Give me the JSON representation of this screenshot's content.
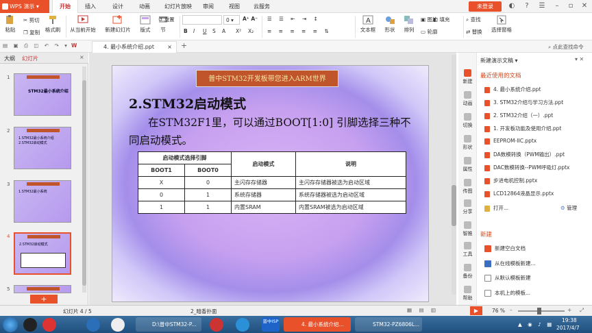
{
  "app": {
    "name": "WPS 演示",
    "login_label": "未登录"
  },
  "menu_tabs": [
    "开始",
    "插入",
    "设计",
    "动画",
    "幻灯片放映",
    "审阅",
    "视图",
    "云服务"
  ],
  "ribbon": {
    "paste": "粘贴",
    "cut": "剪切",
    "copy": "复制",
    "format_painter": "格式刷",
    "from_current": "从当前开始",
    "new_slide": "新建幻灯片",
    "layout": "版式",
    "section": "节",
    "reset": "重置",
    "font_size": "0",
    "textbox": "文本框",
    "shape": "形状",
    "arrange": "排列",
    "picture": "图片",
    "fill": "填充",
    "outline": "轮廓",
    "find": "查找",
    "replace": "替换",
    "select_pane": "选择窗格"
  },
  "quickbar": {
    "doc_tab": "4. 最小系统介绍.ppt",
    "quick_search": "点此查找命令"
  },
  "left_panel": {
    "tab_outline": "大纲",
    "tab_slides": "幻灯片"
  },
  "thumbnails": [
    {
      "num": "1",
      "text": "STM32最小系统介绍"
    },
    {
      "num": "2",
      "text": "1.STM32最小系统介绍 2.STM32启动模式"
    },
    {
      "num": "3",
      "text": "1.STM32最小系统"
    },
    {
      "num": "4",
      "text": "2.STM32启动模式"
    },
    {
      "num": "5",
      "text": ""
    }
  ],
  "slide": {
    "header": "普中STM32开发板带您进入ARM世界",
    "title": "2.STM32启动模式",
    "body": "在STM32F1里，可以通过BOOT[1:0] 引脚选择三种不同启动模式。",
    "table": {
      "h_group": "启动模式选择引脚",
      "h_mode": "启动模式",
      "h_desc": "说明",
      "h_boot1": "BOOT1",
      "h_boot0": "BOOT0",
      "rows": [
        {
          "b1": "X",
          "b0": "0",
          "mode": "主闪存存储器",
          "desc": "主闪存存储器被选为启动区域"
        },
        {
          "b1": "0",
          "b0": "1",
          "mode": "系统存储器",
          "desc": "系统存储器被选为启动区域"
        },
        {
          "b1": "1",
          "b0": "1",
          "mode": "内置SRAM",
          "desc": "内置SRAM被选为启动区域"
        }
      ]
    }
  },
  "right_panel": {
    "title": "新建演示文稿",
    "recent_header": "最近使用的文档",
    "recent": [
      "4. 最小系统介绍.ppt",
      "3. STM32介绍与学习方法.ppt",
      "2. STM32介绍（一）.ppt",
      "1. 开发板功能及使用介绍.ppt",
      "EEPROM-IIC.pptx",
      "DA数模转换（PWM输出）.ppt",
      "DAC数模转换--PWM呼吸灯.pptx",
      "步进电机控制.pptx",
      "LCD12864液晶显示.pptx"
    ],
    "open": "打开...",
    "manage": "管理",
    "new_header": "新建",
    "new_items": [
      "新建空白文档",
      "从在线模板新建...",
      "从默认模板新建",
      "本机上的模板..."
    ],
    "side_icons": [
      "新建",
      "动画",
      "切换",
      "形状",
      "属性",
      "传图",
      "分享",
      "智推",
      "工具",
      "备份",
      "帮助"
    ]
  },
  "statusbar": {
    "slide_info": "幻灯片 4 / 5",
    "theme": "2_暗香扑面",
    "zoom": "76 %"
  },
  "taskbar": {
    "items": [
      "D:\\普中STM32-P...",
      "普中ISP",
      "4. 最小系统介绍...",
      "STM32-PZ6806L..."
    ],
    "time": "19:38",
    "date": "2017/4/7"
  }
}
